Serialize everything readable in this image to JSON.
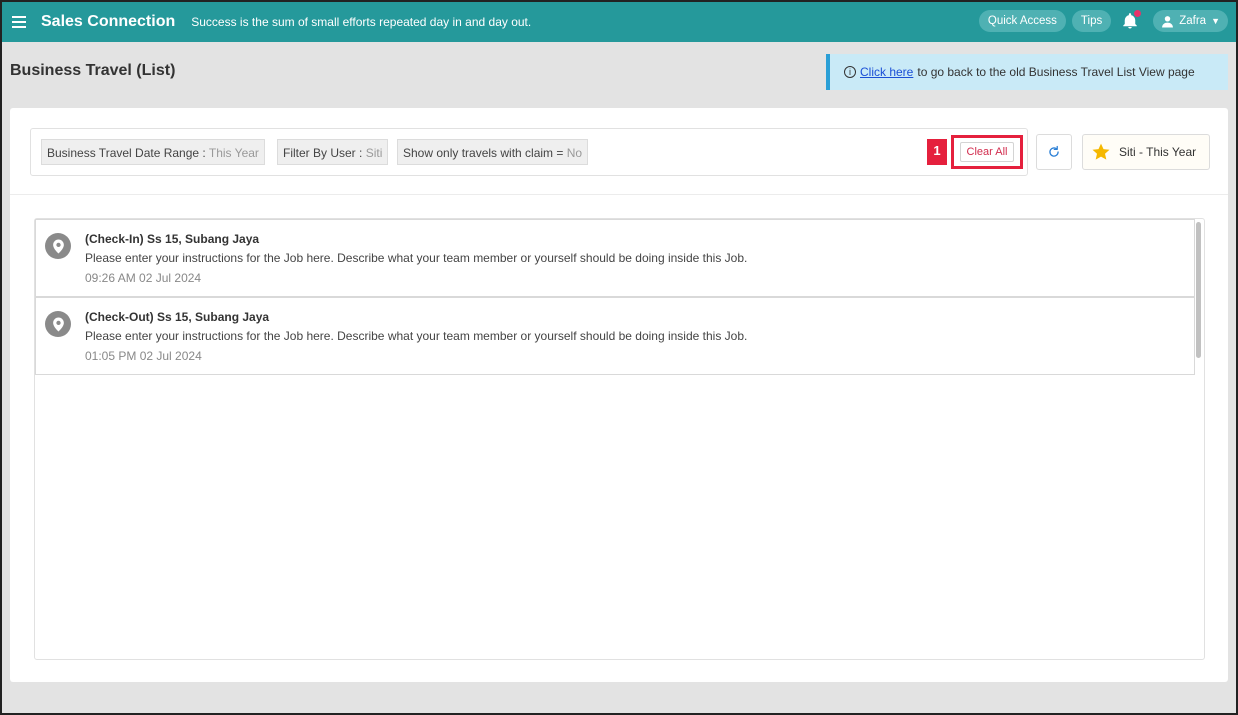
{
  "topbar": {
    "brand": "Sales Connection",
    "tagline": "Success is the sum of small efforts repeated day in and day out.",
    "quick_access": "Quick Access",
    "tips": "Tips",
    "user": "Zafra"
  },
  "page": {
    "title": "Business Travel (List)",
    "banner_link": "Click here",
    "banner_text": "to go back to the old Business Travel List View page"
  },
  "filters": {
    "chips": [
      {
        "label": "Business Travel Date Range",
        "sep": " : ",
        "value": "This Year"
      },
      {
        "label": "Filter By User",
        "sep": " : ",
        "value": "Siti"
      },
      {
        "label": "Show only travels with claim",
        "sep": " = ",
        "value": "No"
      }
    ],
    "step_number": "1",
    "clear_all": "Clear All",
    "favorite": "Siti - This Year"
  },
  "travels": [
    {
      "title": "(Check-In) Ss 15, Subang Jaya",
      "description": "Please enter your instructions for the Job here. Describe what your team member or yourself should be doing inside this Job.",
      "time": "09:26 AM  02 Jul 2024"
    },
    {
      "title": "(Check-Out) Ss 15, Subang Jaya",
      "description": "Please enter your instructions for the Job here. Describe what your team member or yourself should be doing inside this Job.",
      "time": "01:05 PM  02 Jul 2024"
    }
  ],
  "colors": {
    "topbar": "#25999b",
    "accent_red": "#e5203d",
    "banner_bg": "#c9eaf7"
  }
}
